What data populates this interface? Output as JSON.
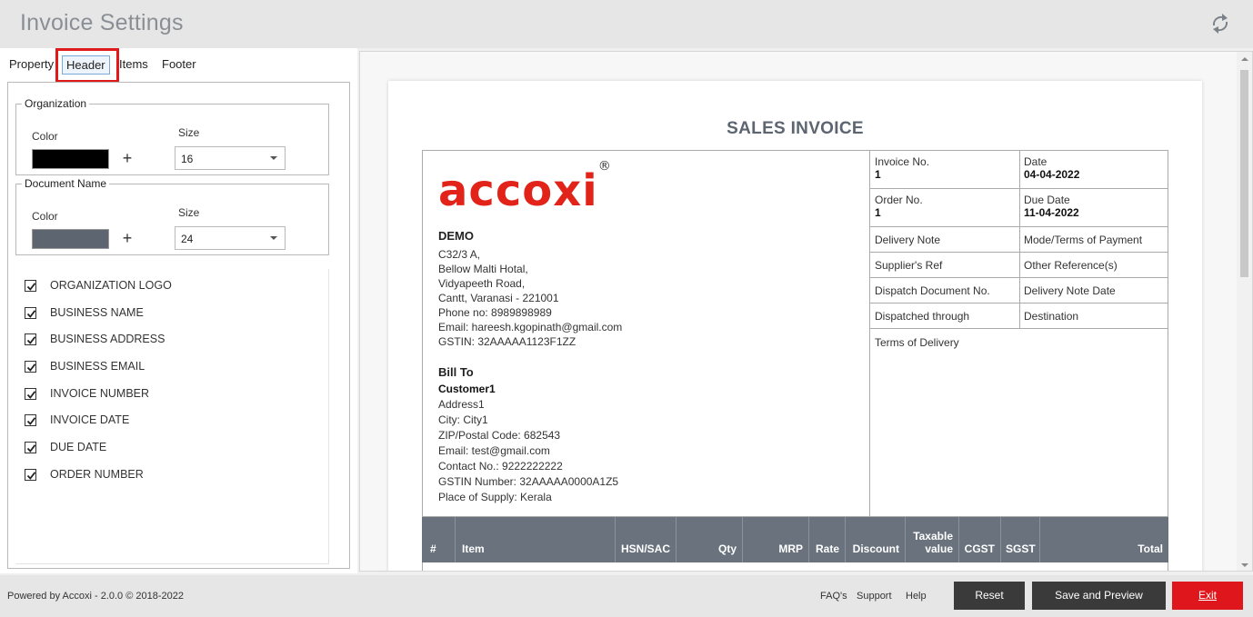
{
  "window": {
    "title": "Invoice Settings",
    "refresh_icon": "refresh-icon"
  },
  "tabs": [
    {
      "label": "Property"
    },
    {
      "label": "Header",
      "active": true
    },
    {
      "label": "Items"
    },
    {
      "label": "Footer"
    }
  ],
  "organization": {
    "legend": "Organization",
    "color_label": "Color",
    "color_value": "#000000",
    "size_label": "Size",
    "size_value": "16",
    "plus": "+"
  },
  "document_name": {
    "legend": "Document Name",
    "color_label": "Color",
    "color_value": "#5c6570",
    "size_label": "Size",
    "size_value": "24",
    "plus": "+"
  },
  "checkboxes": [
    {
      "label": "ORGANIZATION LOGO",
      "checked": true
    },
    {
      "label": "BUSINESS NAME",
      "checked": true
    },
    {
      "label": "BUSINESS ADDRESS",
      "checked": true
    },
    {
      "label": "BUSINESS EMAIL",
      "checked": true
    },
    {
      "label": "INVOICE NUMBER",
      "checked": true
    },
    {
      "label": "INVOICE DATE",
      "checked": true
    },
    {
      "label": "DUE DATE",
      "checked": true
    },
    {
      "label": "ORDER NUMBER",
      "checked": true
    }
  ],
  "invoice": {
    "title": "SALES INVOICE",
    "logo_text": "accoxi",
    "logo_mark": "®",
    "business_name": "DEMO",
    "address_lines": [
      "C32/3 A,",
      "Bellow Malti Hotal,",
      "Vidyapeeth Road,",
      "Cantt, Varanasi - 221001",
      "Phone no: 8989898989",
      "Email: hareesh.kgopinath@gmail.com",
      "GSTIN: 32AAAAA1123F1ZZ"
    ],
    "bill_to_label": "Bill To",
    "customer_name": "Customer1",
    "customer_lines": [
      "Address1",
      "City: City1",
      "ZIP/Postal Code: 682543",
      "Email: test@gmail.com",
      "Contact No.: 9222222222",
      "GSTIN Number: 32AAAAA0000A1Z5",
      "Place of Supply: Kerala"
    ],
    "meta": {
      "invoice_no_label": "Invoice No.",
      "invoice_no": "1",
      "date_label": "Date",
      "date": "04-04-2022",
      "order_no_label": "Order No.",
      "order_no": "1",
      "due_date_label": "Due Date",
      "due_date": "11-04-2022",
      "delivery_note": "Delivery Note",
      "mode_terms": "Mode/Terms of Payment",
      "suppliers_ref": "Supplier's Ref",
      "other_ref": "Other Reference(s)",
      "dispatch_doc_no": "Dispatch Document No.",
      "delivery_note_date": "Delivery Note Date",
      "dispatched_through": "Dispatched through",
      "destination": "Destination",
      "terms_of_delivery": "Terms of Delivery"
    },
    "columns": {
      "num": "#",
      "item": "Item",
      "hsn": "HSN/SAC",
      "qty": "Qty",
      "mrp": "MRP",
      "rate": "Rate",
      "discount": "Discount",
      "taxable1": "Taxable",
      "taxable2": "value",
      "cgst": "CGST",
      "sgst": "SGST",
      "total": "Total"
    },
    "header_color": "#6a737d"
  },
  "footer": {
    "powered": "Powered by Accoxi - 2.0.0 © 2018-2022",
    "faq": "FAQ's",
    "support": "Support",
    "help": "Help",
    "reset": "Reset",
    "save_preview": "Save and Preview",
    "exit": "Exit"
  }
}
